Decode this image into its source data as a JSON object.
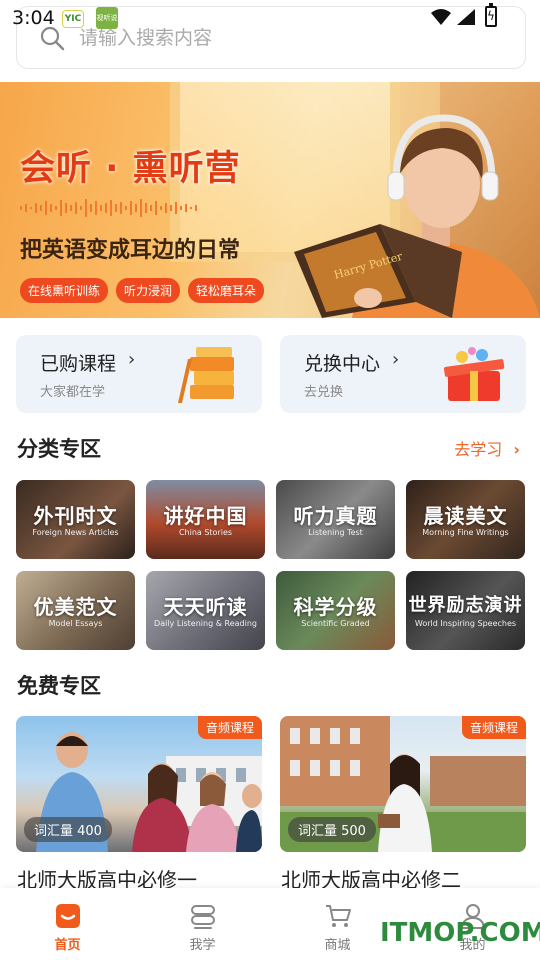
{
  "status_bar": {
    "time": "3:04",
    "badge1": "YIC",
    "badge2": "视听说"
  },
  "search": {
    "placeholder": "请输入搜索内容"
  },
  "banner": {
    "title": "会听 · 熏听营",
    "subtitle": "把英语变成耳边的日常",
    "tags": [
      "在线熏听训练",
      "听力浸润",
      "轻松磨耳朵"
    ],
    "book_text": "Harry Potter"
  },
  "quick_cards": [
    {
      "title": "已购课程",
      "subtitle": "大家都在学"
    },
    {
      "title": "兑换中心",
      "subtitle": "去兑换"
    }
  ],
  "category_section": {
    "title": "分类专区",
    "more": "去学习"
  },
  "categories": [
    {
      "cn": "外刊时文",
      "en": "Foreign News Articles",
      "color": "#5a3a2a"
    },
    {
      "cn": "讲好中国",
      "en": "China Stories",
      "color": "#b3472c"
    },
    {
      "cn": "听力真题",
      "en": "Listening Test",
      "color": "#6b6b6b"
    },
    {
      "cn": "晨读美文",
      "en": "Morning Fine Writings",
      "color": "#5b3d28"
    },
    {
      "cn": "优美范文",
      "en": "Model Essays",
      "color": "#8d7a62"
    },
    {
      "cn": "天天听读",
      "en": "Daily Listening & Reading",
      "color": "#7e7e86"
    },
    {
      "cn": "科学分级",
      "en": "Scientific Graded",
      "color": "#4e6b4a"
    },
    {
      "cn": "世界励志演讲",
      "en": "World Inspiring Speeches",
      "color": "#3b3b3b"
    }
  ],
  "free_section": {
    "title": "免费专区"
  },
  "free_courses": [
    {
      "badge": "音频课程",
      "vocab": "词汇量 400",
      "title": "北师大版高中必修一"
    },
    {
      "badge": "音频课程",
      "vocab": "词汇量 500",
      "title": "北师大版高中必修二"
    }
  ],
  "tabs": [
    {
      "label": "首页",
      "icon": "home-icon",
      "active": true
    },
    {
      "label": "我学",
      "icon": "study-icon",
      "active": false
    },
    {
      "label": "商城",
      "icon": "cart-icon",
      "active": false
    },
    {
      "label": "我的",
      "icon": "profile-icon",
      "active": false
    }
  ],
  "watermark": "ITMOP.COM",
  "colors": {
    "accent": "#f25a1c",
    "link": "#f0652a",
    "card_bg": "#eef3f9"
  }
}
